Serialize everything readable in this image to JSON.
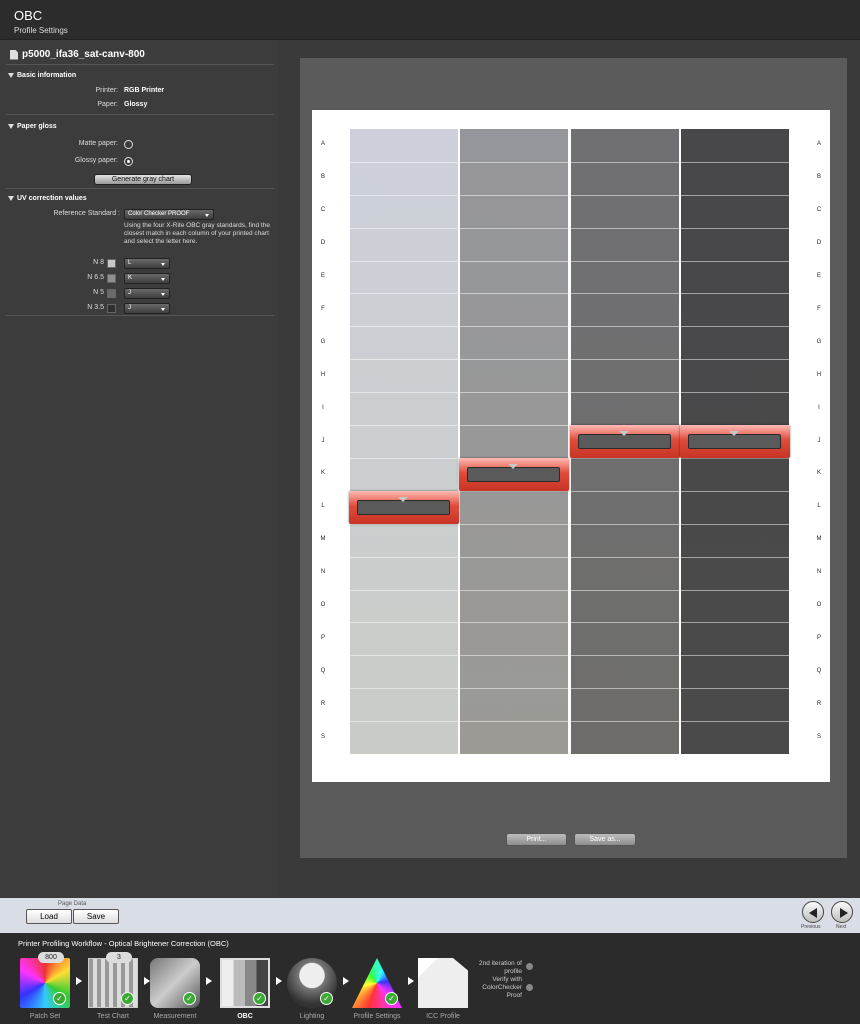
{
  "header": {
    "title": "OBC",
    "subtitle": "Profile Settings"
  },
  "left": {
    "document_name": "p5000_ifa36_sat-canv-800",
    "basic": {
      "heading": "Basic information",
      "printer_label": "Printer:",
      "printer_value": "RGB Printer",
      "paper_label": "Paper:",
      "paper_value": "Glossy"
    },
    "gloss": {
      "heading": "Paper gloss",
      "matte_label": "Matte paper:",
      "glossy_label": "Glossy paper:",
      "selected": "glossy",
      "generate_button": "Generate gray chart"
    },
    "uv": {
      "heading": "UV correction values",
      "ref_label": "Reference Standard :",
      "ref_value": "Color Checker PROOF",
      "description": "Using the four X-Rite OBC gray standards, find the closest match in each column of your printed chart and select the letter here.",
      "rows": [
        {
          "label": "N 8",
          "value": "L",
          "swatch": "#c8c8c8"
        },
        {
          "label": "N 6.5",
          "value": "K",
          "swatch": "#8f8f8f"
        },
        {
          "label": "N 5",
          "value": "J",
          "swatch": "#6a6a6a"
        },
        {
          "label": "N 3.5",
          "value": "J",
          "swatch": "#303030"
        }
      ]
    }
  },
  "chart": {
    "rows": [
      "A",
      "B",
      "C",
      "D",
      "E",
      "F",
      "G",
      "H",
      "I",
      "J",
      "K",
      "L",
      "M",
      "N",
      "O",
      "P",
      "Q",
      "R",
      "S"
    ],
    "columns": [
      {
        "name": "N 8",
        "top": "#cdd0da",
        "bottom": "#c9ccc6",
        "selected": "L"
      },
      {
        "name": "N 6.5",
        "top": "#95969b",
        "bottom": "#9b9a95",
        "selected": "K"
      },
      {
        "name": "N 5",
        "top": "#707074",
        "bottom": "#6e6d6a",
        "selected": "J"
      },
      {
        "name": "N 3.5",
        "top": "#48484b",
        "bottom": "#4a4a4a",
        "selected": "J"
      }
    ],
    "print_button": "Print...",
    "saveas_button": "Save as..."
  },
  "pagedata": {
    "label": "Page Data",
    "load": "Load",
    "save": "Save",
    "previous": "Previous",
    "next": "Next"
  },
  "workflow": {
    "title": "Printer Profiling Workflow - Optical Brightener Correction (OBC)",
    "steps": [
      {
        "label": "Patch Set",
        "badge": "800"
      },
      {
        "label": "Test Chart",
        "badge": "3"
      },
      {
        "label": "Measurement",
        "badge": ""
      },
      {
        "label": "OBC",
        "badge": ""
      },
      {
        "label": "Lighting",
        "badge": ""
      },
      {
        "label": "Profile Settings",
        "badge": ""
      },
      {
        "label": "ICC Profile",
        "badge": ""
      }
    ],
    "note1": "2nd iteration of profile",
    "note2": "Verify with ColorChecker Proof"
  }
}
